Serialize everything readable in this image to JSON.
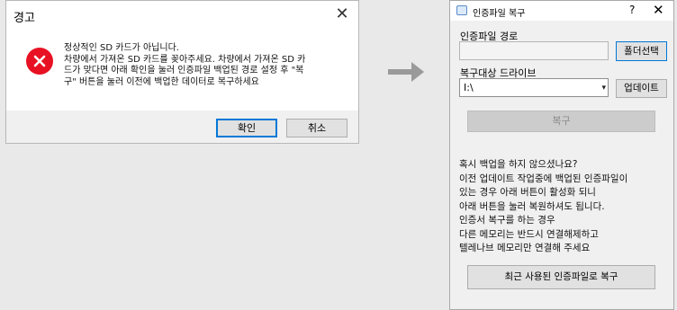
{
  "alert": {
    "title": "경고",
    "close_glyph": "✕",
    "message_lines": [
      "정상적인 SD 카드가 아닙니다.",
      "차량에서 가져온 SD 카드를 꽂아주세요. 차량에서 가져온 SD 카",
      "드가 맞다면 아래 확인을 눌러 인증파일 백업된 경로 설정 후 \"복",
      "구\" 버튼을 눌러 이전에 백업한 데이터로 복구하세요"
    ],
    "ok_label": "확인",
    "cancel_label": "취소",
    "icon": "error-icon",
    "icon_color": "#e81123"
  },
  "arrow": {
    "icon": "right-arrow-icon",
    "color": "#9a9a9a"
  },
  "restore": {
    "title": "인증파일 복구",
    "help_glyph": "?",
    "close_glyph": "✕",
    "path_label": "인증파일 경로",
    "path_value": "",
    "folder_select_label": "폴더선택",
    "drive_label": "복구대상 드라이브",
    "drive_value": "I:\\",
    "drive_dropdown_glyph": "▾",
    "update_label": "업데이트",
    "restore_label": "복구",
    "info_lines": [
      "혹시 백업을 하지 않으셨나요?",
      "이전 업데이트 작업중에 백업된 인증파일이",
      "있는 경우 아래 버튼이 활성화 되니",
      "아래 버튼을 눌러 복원하셔도 됩니다.",
      "인증서 복구를 하는 경우",
      "다른 메모리는 반드시 연결해제하고",
      "텔레나브 메모리만 연결해 주세요"
    ],
    "recent_restore_label": "최근 사용된 인증파일로 복구"
  }
}
